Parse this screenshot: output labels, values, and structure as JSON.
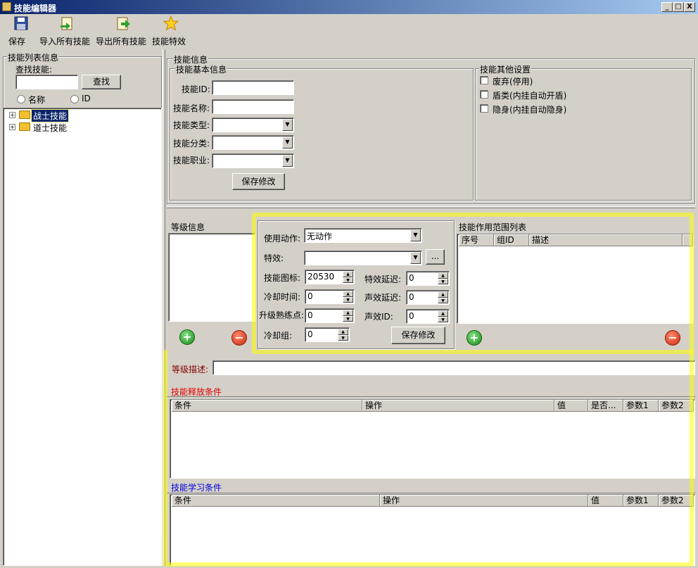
{
  "window": {
    "title": "技能编辑器",
    "controls": [
      "_",
      "□",
      "X"
    ]
  },
  "toolbar": [
    {
      "label": "保存",
      "icon": "floppy-disk-icon"
    },
    {
      "label": "导入所有技能",
      "icon": "import-icon"
    },
    {
      "label": "导出所有技能",
      "icon": "export-icon"
    },
    {
      "label": "技能特效",
      "icon": "star-icon"
    }
  ],
  "left": {
    "group_title": "技能列表信息",
    "search_label": "查找技能:",
    "search_value": "",
    "search_button": "查找",
    "radio_name": "名称",
    "radio_id": "ID",
    "tree": [
      {
        "label": "战士技能",
        "selected": true
      },
      {
        "label": "道士技能",
        "selected": false
      }
    ]
  },
  "skill_info": {
    "title": "技能信息",
    "basic_title": "技能基本信息",
    "fields": {
      "id_label": "技能ID:",
      "name_label": "技能名称:",
      "type_label": "技能类型:",
      "category_label": "技能分类:",
      "job_label": "技能职业:"
    },
    "save_button": "保存修改",
    "other_title": "技能其他设置",
    "checkboxes": [
      "废弃(停用)",
      "盾类(内挂自动开盾)",
      "隐身(内挂自动隐身)"
    ]
  },
  "level": {
    "title": "等级信息",
    "use_action_label": "使用动作:",
    "use_action_value": "无动作",
    "effect_label": "特效:",
    "effect_value": "",
    "effect_browse": "...",
    "icon_label": "技能图标:",
    "icon_value": "20530",
    "effect_delay_label": "特效延迟:",
    "effect_delay_value": "0",
    "cooldown_label": "冷却时间:",
    "cooldown_value": "0",
    "sound_delay_label": "声效延迟:",
    "sound_delay_value": "0",
    "upgrade_label": "升级熟练点:",
    "upgrade_value": "0",
    "sound_id_label": "声效ID:",
    "sound_id_value": "0",
    "cd_group_label": "冷却组:",
    "cd_group_value": "0",
    "save_button": "保存修改",
    "add": "+",
    "remove": "−",
    "desc_label": "等级描述:",
    "desc_value": ""
  },
  "scope": {
    "title": "技能作用范围列表",
    "columns": [
      "序号",
      "组ID",
      "描述"
    ]
  },
  "release": {
    "title": "技能释放条件",
    "title_color": "#e00000",
    "columns": [
      "条件",
      "操作",
      "值",
      "是否...",
      "参数1",
      "参数2"
    ]
  },
  "learn": {
    "title": "技能学习条件",
    "title_color": "#0000e0",
    "columns": [
      "条件",
      "操作",
      "值",
      "参数1",
      "参数2"
    ]
  },
  "colors": {
    "titlebar_start": "#0a246a",
    "titlebar_end": "#a6caf0",
    "highlight": "#ffff00",
    "face": "#d4d0c8"
  }
}
